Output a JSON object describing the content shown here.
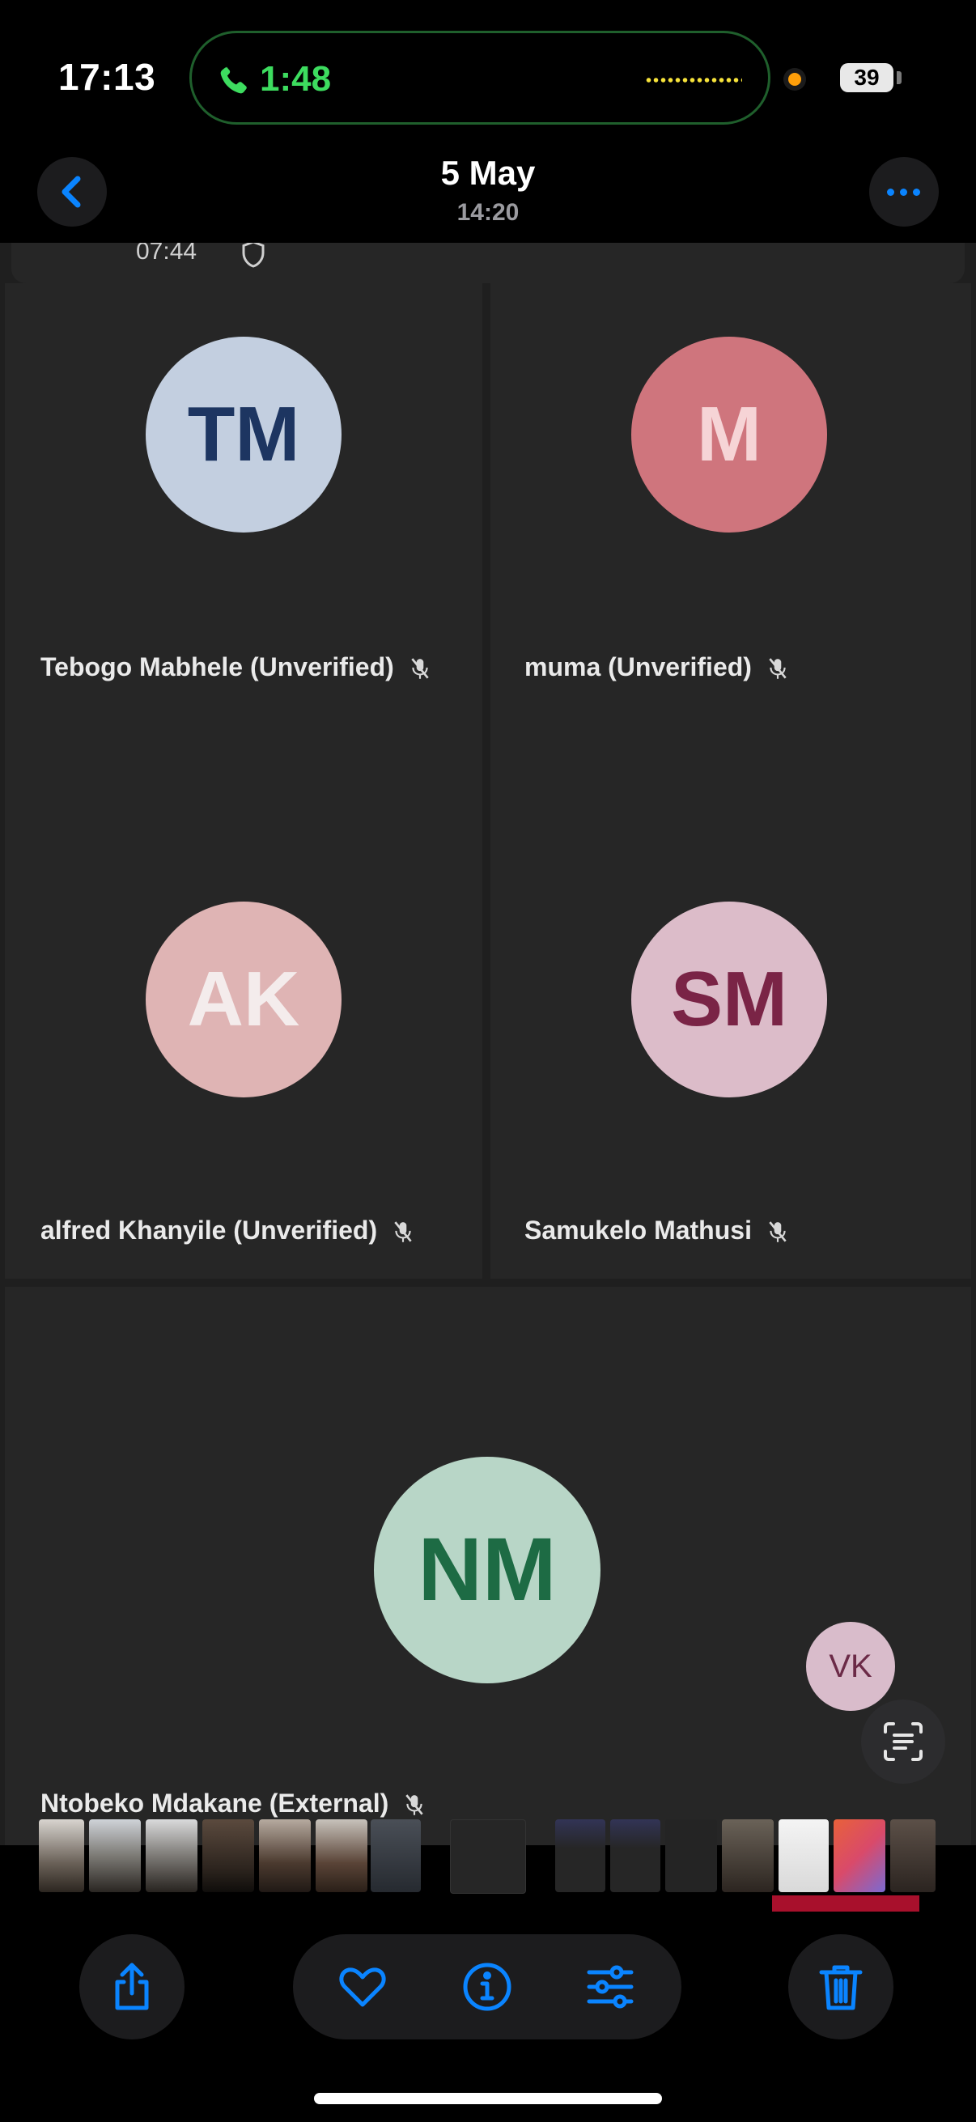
{
  "status_bar": {
    "time": "17:13",
    "call_duration": "1:48",
    "battery": "39"
  },
  "nav": {
    "title": "5 May",
    "subtitle": "14:20"
  },
  "meeting": {
    "top_time": "07:44",
    "participants": [
      {
        "initials": "TM",
        "name": "Tebogo Mabhele (Unverified)",
        "avatar_bg": "#c3cfe0",
        "text_color": "#1d3561"
      },
      {
        "initials": "M",
        "name": "muma (Unverified)",
        "avatar_bg": "#cf757d",
        "text_color": "#f6d4d6"
      },
      {
        "initials": "AK",
        "name": "alfred Khanyile (Unverified)",
        "avatar_bg": "#dfb4b4",
        "text_color": "#f4ecec"
      },
      {
        "initials": "SM",
        "name": "Samukelo Mathusi",
        "avatar_bg": "#dcbcc9",
        "text_color": "#7a2446"
      },
      {
        "initials": "NM",
        "name": "Ntobeko Mdakane (External)",
        "avatar_bg": "#b8d6c7",
        "text_color": "#1d6b44"
      }
    ],
    "self_view": {
      "initials": "VK",
      "avatar_bg": "#d9bccb",
      "text_color": "#6b2a47"
    }
  },
  "toolbar": {
    "share_icon": "share-icon",
    "favorite_icon": "heart-icon",
    "info_icon": "info-icon",
    "adjust_icon": "sliders-icon",
    "delete_icon": "trash-icon"
  },
  "colors": {
    "accent": "#0a84ff",
    "call_green": "#3ddc5f"
  }
}
